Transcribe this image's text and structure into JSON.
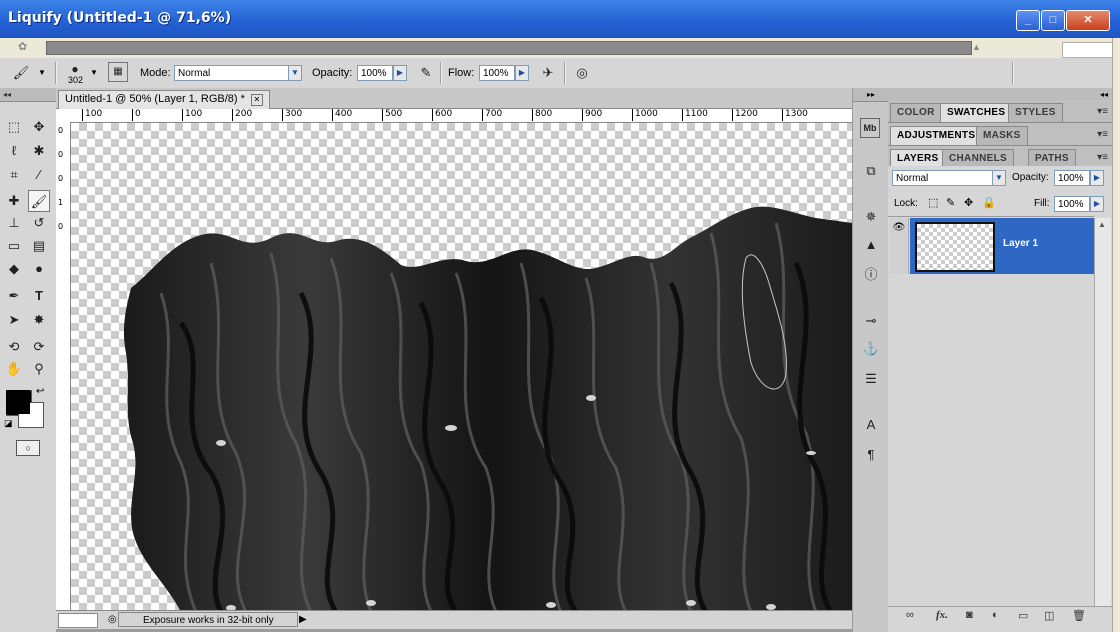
{
  "window": {
    "title": "Liquify (Untitled-1 @ 71,6%)",
    "min": "_",
    "max": "□",
    "close": "✕"
  },
  "options": {
    "brush_size": "302",
    "mode_label": "Mode:",
    "mode_value": "Normal",
    "opacity_label": "Opacity:",
    "opacity_value": "100%",
    "flow_label": "Flow:",
    "flow_value": "100%"
  },
  "document": {
    "tab_title": "Untitled-1 @ 50% (Layer 1, RGB/8) *",
    "tab_close": "✕",
    "ruler_h": [
      "100",
      "0",
      "100",
      "200",
      "300",
      "400",
      "500",
      "600",
      "700",
      "800",
      "900",
      "1000",
      "1100",
      "1200",
      "1300"
    ],
    "ruler_v": [
      "0",
      "0",
      "0",
      "1",
      "0"
    ],
    "status_message": "Exposure works in 32-bit only"
  },
  "panels": {
    "group1_tabs": [
      "COLOR",
      "SWATCHES",
      "STYLES"
    ],
    "group2_tabs": [
      "ADJUSTMENTS",
      "MASKS"
    ],
    "group3_tabs": [
      "LAYERS",
      "CHANNELS",
      "PATHS"
    ],
    "blend_mode": "Normal",
    "opacity_label": "Opacity:",
    "opacity_value": "100%",
    "lock_label": "Lock:",
    "fill_label": "Fill:",
    "fill_value": "100%",
    "layer_name": "Layer 1"
  },
  "dock": {
    "mb_label": "Mb"
  },
  "colors": {
    "accent": "#2f67c4",
    "titlebar": "#2461d4"
  }
}
